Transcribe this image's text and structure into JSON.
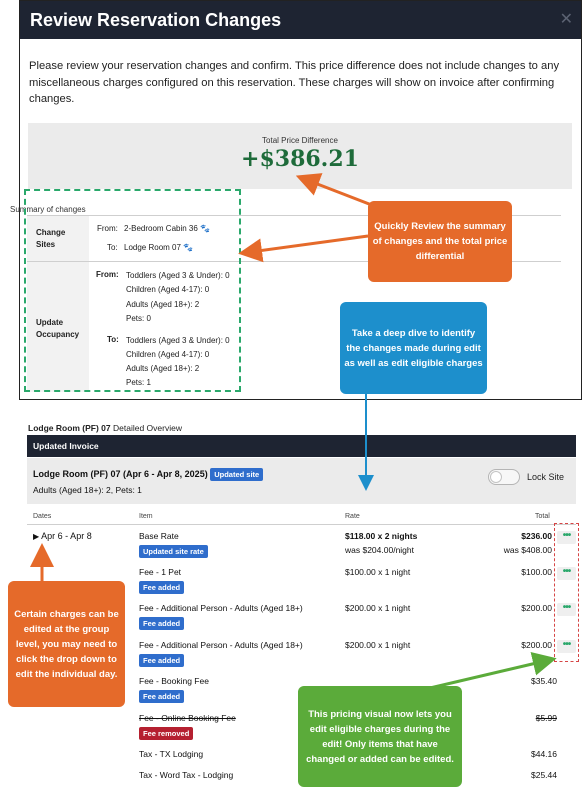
{
  "modal": {
    "title": "Review Reservation Changes",
    "close_glyph": "✕",
    "description": "Please review your reservation changes and confirm. This price difference does not include changes to any miscellaneous charges configured on this reservation. These charges will show on invoice after confirming changes.",
    "total_label": "Total Price Difference",
    "total_value": "+$386.21",
    "summary_title": "Summary of changes",
    "change_sites": {
      "label_1": "Change",
      "label_2": "Sites",
      "from_label": "From:",
      "from_value": "2-Bedroom Cabin 36",
      "to_label": "To:",
      "to_value": "Lodge Room 07",
      "pet_icon": "paw-icon"
    },
    "update_occupancy": {
      "label_1": "Update",
      "label_2": "Occupancy",
      "from_label": "From:",
      "from_lines": [
        "Toddlers (Aged 3 & Under): 0",
        "Children (Aged 4-17): 0",
        "Adults (Aged 18+): 2",
        "Pets: 0"
      ],
      "to_label": "To:",
      "to_lines": [
        "Toddlers (Aged 3 & Under): 0",
        "Children (Aged 4-17): 0",
        "Adults (Aged 18+): 2",
        "Pets: 1"
      ]
    }
  },
  "lodge": {
    "title_bold": "Lodge Room (PF) 07",
    "title_rest": " Detailed Overview",
    "invoice_bar": "Updated Invoice",
    "room_name": "Lodge Room (PF) 07 (Apr 6 - Apr 8, 2025)",
    "room_badge": "Updated site",
    "room_sub": "Adults (Aged 18+): 2, Pets: 1",
    "lock_label": "Lock Site",
    "headers": {
      "dates": "Dates",
      "item": "Item",
      "rate": "Rate",
      "total": "Total"
    },
    "date_range": "Apr 6 - Apr 8",
    "rows": [
      {
        "item": "Base Rate",
        "badge": "Updated site rate",
        "rate": "$118.00 x 2 nights",
        "rate_sub": "was $204.00/night",
        "total": "$236.00",
        "total_sub": "was $408.00"
      },
      {
        "item": "Fee - 1 Pet",
        "badge": "Fee added",
        "rate": "$100.00 x 1 night",
        "total": "$100.00"
      },
      {
        "item": "Fee - Additional Person - Adults (Aged 18+)",
        "badge": "Fee added",
        "rate": "$200.00 x 1 night",
        "total": "$200.00"
      },
      {
        "item": "Fee - Additional Person - Adults (Aged 18+)",
        "badge": "Fee added",
        "rate": "$200.00 x 1 night",
        "total": "$200.00"
      },
      {
        "item": "Fee - Booking Fee",
        "badge": "Fee added",
        "total": "$35.40"
      },
      {
        "item": "Fee - Online Booking Fee",
        "badge": "Fee removed",
        "total": "$5.99"
      },
      {
        "item": "Tax - TX Lodging",
        "total": "$44.16"
      },
      {
        "item": "Tax - Word Tax - Lodging",
        "total": "$25.44"
      }
    ],
    "more_glyph": "•••"
  },
  "callouts": {
    "review": "Quickly Review the summary of changes and the total price differential",
    "deep_dive": "Take a deep dive to identify the changes made during edit as well as edit eligible charges",
    "group_level": "Certain charges can be edited at the group level, you may need to click the drop down to edit the individual day.",
    "pricing": "This pricing visual now lets you edit eligible charges during the edit! Only items that have changed or added can be edited."
  },
  "colors": {
    "header_bg": "#1e2432",
    "total_green": "#1e6b3a",
    "badge_blue": "#2f6dcc",
    "badge_red": "#b52030",
    "callout_orange": "#e56a2a",
    "callout_blue": "#1d8fcc",
    "callout_green": "#5bab3a",
    "dashed_green": "#2aa86b",
    "dashed_red": "#d64545"
  }
}
